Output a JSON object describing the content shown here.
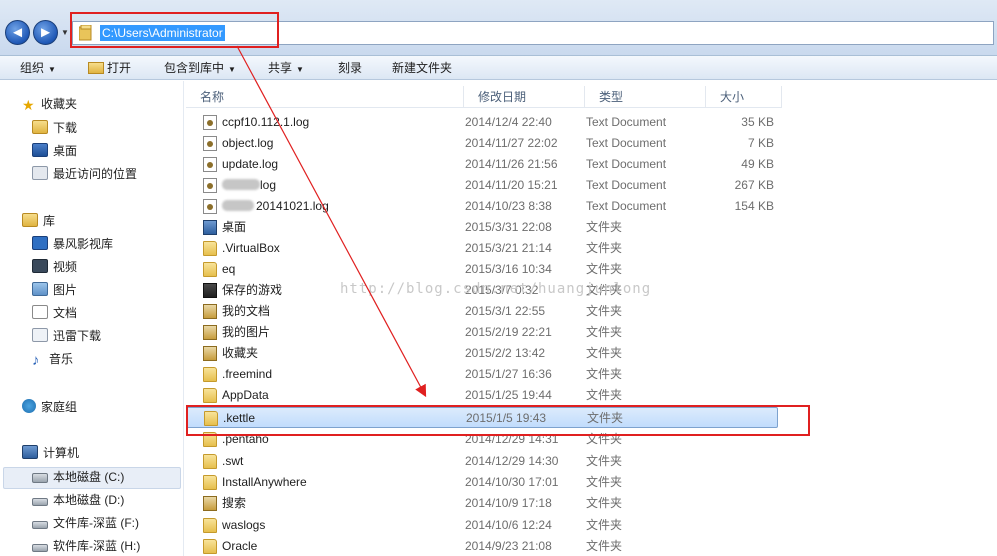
{
  "address": {
    "path": "C:\\Users\\Administrator",
    "back_symbol": "◄",
    "forward_symbol": "►"
  },
  "toolbar": {
    "organize": "组织",
    "open": "打开",
    "include_in_library": "包含到库中",
    "share": "共享",
    "burn": "刻录",
    "new_folder": "新建文件夹"
  },
  "nav": {
    "favorites": "收藏夹",
    "downloads": "下载",
    "desktop": "桌面",
    "recent_places": "最近访问的位置",
    "libraries": "库",
    "baofeng": "暴风影视库",
    "videos": "视频",
    "pictures": "图片",
    "documents": "文档",
    "xunlei": "迅雷下载",
    "music": "音乐",
    "homegroup": "家庭组",
    "computer": "计算机",
    "drive_c": "本地磁盘 (C:)",
    "drive_d": "本地磁盘 (D:)",
    "drive_f": "文件库-深蓝 (F:)",
    "drive_h": "软件库-深蓝 (H:)"
  },
  "columns": {
    "name": "名称",
    "modified": "修改日期",
    "type": "类型",
    "size": "大小"
  },
  "files": [
    {
      "name": "ccpf10.112.1.log",
      "date": "2014/12/4 22:40",
      "type": "Text Document",
      "size": "35 KB",
      "icon": "log-file-icon"
    },
    {
      "name": "object.log",
      "date": "2014/11/27 22:02",
      "type": "Text Document",
      "size": "7 KB",
      "icon": "log-file-icon"
    },
    {
      "name": "update.log",
      "date": "2014/11/26 21:56",
      "type": "Text Document",
      "size": "49 KB",
      "icon": "log-file-icon"
    },
    {
      "name": "log",
      "date": "2014/11/20 15:21",
      "type": "Text Document",
      "size": "267 KB",
      "icon": "log-file-icon"
    },
    {
      "name": "20141021.log",
      "date": "2014/10/23 8:38",
      "type": "Text Document",
      "size": "154 KB",
      "icon": "log-file-icon"
    },
    {
      "name": "桌面",
      "date": "2015/3/31 22:08",
      "type": "文件夹",
      "size": "",
      "icon": "desktop-folder-icon"
    },
    {
      "name": ".VirtualBox",
      "date": "2015/3/21 21:14",
      "type": "文件夹",
      "size": "",
      "icon": "folder-icon"
    },
    {
      "name": "eq",
      "date": "2015/3/16 10:34",
      "type": "文件夹",
      "size": "",
      "icon": "folder-icon"
    },
    {
      "name": "保存的游戏",
      "date": "2015/3/7 0:32",
      "type": "文件夹",
      "size": "",
      "icon": "saved-games-folder-icon"
    },
    {
      "name": "我的文档",
      "date": "2015/3/1 22:55",
      "type": "文件夹",
      "size": "",
      "icon": "documents-folder-icon"
    },
    {
      "name": "我的图片",
      "date": "2015/2/19 22:21",
      "type": "文件夹",
      "size": "",
      "icon": "pictures-folder-icon"
    },
    {
      "name": "收藏夹",
      "date": "2015/2/2 13:42",
      "type": "文件夹",
      "size": "",
      "icon": "favorites-folder-icon"
    },
    {
      "name": ".freemind",
      "date": "2015/1/27 16:36",
      "type": "文件夹",
      "size": "",
      "icon": "folder-icon"
    },
    {
      "name": "AppData",
      "date": "2015/1/25 19:44",
      "type": "文件夹",
      "size": "",
      "icon": "folder-icon"
    },
    {
      "name": ".kettle",
      "date": "2015/1/5 19:43",
      "type": "文件夹",
      "size": "",
      "icon": "folder-icon"
    },
    {
      "name": ".pentaho",
      "date": "2014/12/29 14:31",
      "type": "文件夹",
      "size": "",
      "icon": "folder-icon"
    },
    {
      "name": ".swt",
      "date": "2014/12/29 14:30",
      "type": "文件夹",
      "size": "",
      "icon": "folder-icon"
    },
    {
      "name": "InstallAnywhere",
      "date": "2014/10/30 17:01",
      "type": "文件夹",
      "size": "",
      "icon": "folder-icon"
    },
    {
      "name": "搜索",
      "date": "2014/10/9 17:18",
      "type": "文件夹",
      "size": "",
      "icon": "searches-folder-icon"
    },
    {
      "name": "waslogs",
      "date": "2014/10/6 12:24",
      "type": "文件夹",
      "size": "",
      "icon": "folder-icon"
    },
    {
      "name": "Oracle",
      "date": "2014/9/23 21:08",
      "type": "文件夹",
      "size": "",
      "icon": "folder-icon"
    }
  ],
  "watermark": "http://blog.csdn.net/huangjunlong",
  "colors": {
    "selection_blue": "#3399ff",
    "annotation_red": "#e02020",
    "row_selected": "#cde3fb"
  }
}
